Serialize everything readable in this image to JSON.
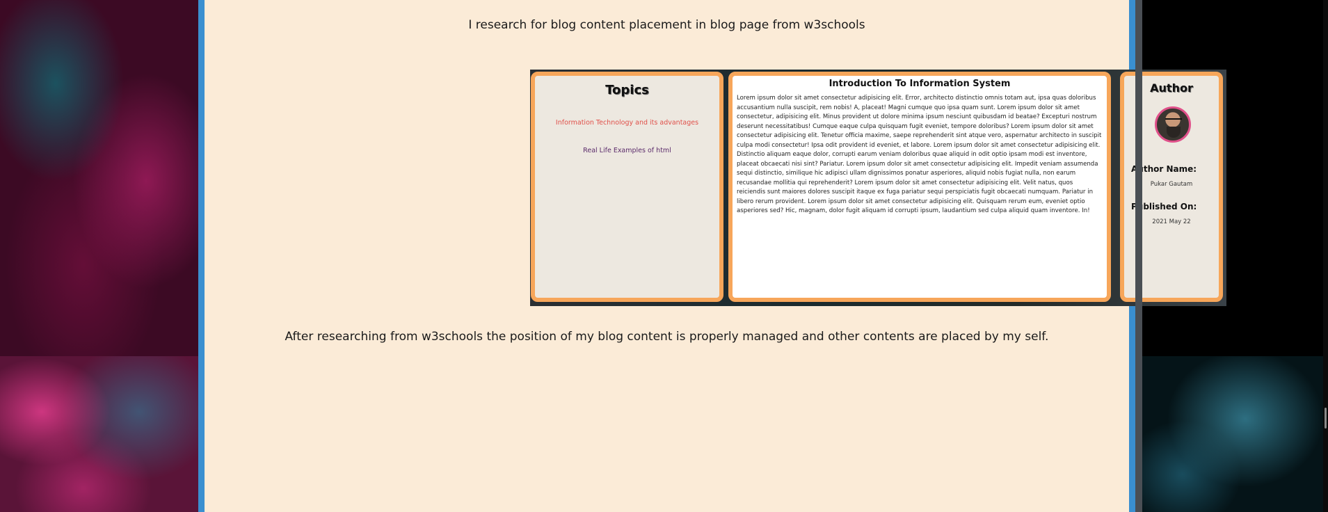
{
  "page": {
    "intro": "I research for blog content placement in blog page from w3schools",
    "outro": "After researching from w3schools the position of my blog content is properly managed and other contents are placed by my self."
  },
  "screenshot": {
    "topics": {
      "title": "Topics",
      "links": [
        "Information Technology and its advantages",
        "Real Life Examples of html"
      ]
    },
    "article": {
      "title": "Introduction To Information System",
      "body": "Lorem ipsum dolor sit amet consectetur adipisicing elit. Error, architecto distinctio omnis totam aut, ipsa quas doloribus accusantium nulla suscipit, rem nobis! A, placeat! Magni cumque quo ipsa quam sunt. Lorem ipsum dolor sit amet consectetur, adipisicing elit. Minus provident ut dolore minima ipsum nesciunt quibusdam id beatae? Excepturi nostrum deserunt necessitatibus! Cumque eaque culpa quisquam fugit eveniet, tempore doloribus? Lorem ipsum dolor sit amet consectetur adipisicing elit. Tenetur officia maxime, saepe reprehenderit sint atque vero, aspernatur architecto in suscipit culpa modi consectetur! Ipsa odit provident id eveniet, et labore. Lorem ipsum dolor sit amet consectetur adipisicing elit. Distinctio aliquam eaque dolor, corrupti earum veniam doloribus quae aliquid in odit optio ipsam modi est inventore, placeat obcaecati nisi sint? Pariatur. Lorem ipsum dolor sit amet consectetur adipisicing elit. Impedit veniam assumenda sequi distinctio, similique hic adipisci ullam dignissimos ponatur asperiores, aliquid nobis fugiat nulla, non earum recusandae mollitia qui reprehenderit? Lorem ipsum dolor sit amet consectetur adipisicing elit. Velit natus, quos reiciendis sunt maiores dolores suscipit itaque ex fuga pariatur sequi perspiciatis fugit obcaecati numquam. Pariatur in libero rerum provident. Lorem ipsum dolor sit amet consectetur adipisicing elit. Quisquam rerum eum, eveniet optio asperiores sed? Hic, magnam, dolor fugit aliquam id corrupti ipsum, laudantium sed culpa aliquid quam inventore. In!"
    },
    "author": {
      "title": "Author",
      "name_label": "Author Name:",
      "name_value": "Pukar Gautam",
      "published_label": "Published On:",
      "published_value": "2021 May 22"
    }
  },
  "colors": {
    "panel_bg": "#fbebd7",
    "panel_border": "#3a8fd0",
    "card_border": "#f7a65a"
  }
}
